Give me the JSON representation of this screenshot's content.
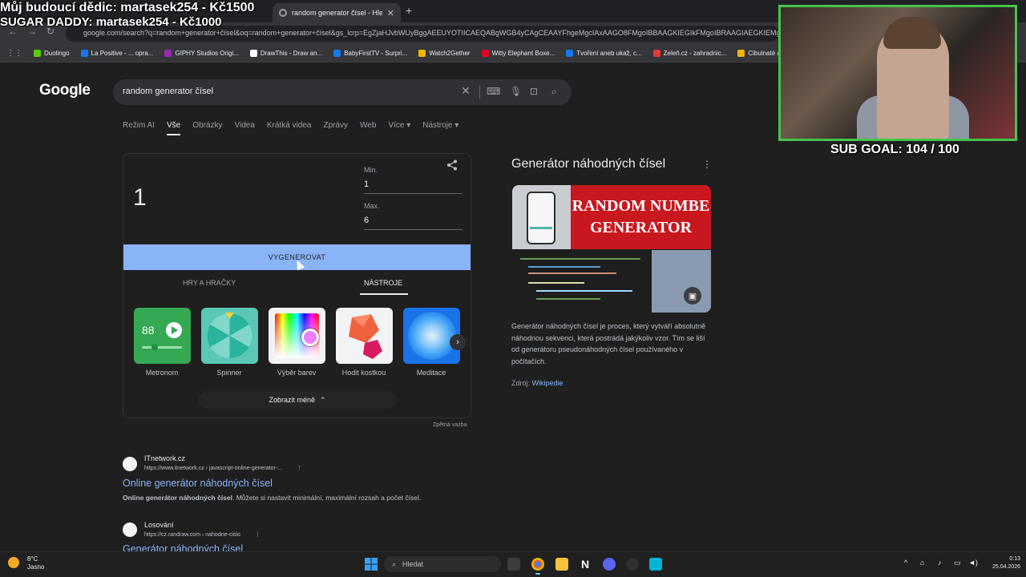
{
  "overlay": {
    "donor_line": "Můj budoucí dědic: martasek254 - Kč1500",
    "sugar_line": "SUGAR DADDY: martasek254 - Kč1000",
    "sub_goal": "SUB GOAL: 104 / 100"
  },
  "browser": {
    "tab_title": "random generator čísel - Hleda",
    "tab_close": "✕",
    "new_tab": "+",
    "url": "google.com/search?q=random+generator+čísel&oq=random+generator+čísel&gs_lcrp=EgZjaHJvbWUyBggAEEUYOTIICAEQABgWGB4yCAgCEAAYFhgeMgcIAxAAGO8FMgoIBBAAGKIEGIkFMgoIBRAAGIAEGKIEMgcIBhAAGO8F",
    "bookmarks": [
      {
        "label": "Duolingo",
        "color": "#58cc02"
      },
      {
        "label": "La Positive - ... opra...",
        "color": "#1877f2"
      },
      {
        "label": "GIPHY Studios Origi...",
        "color": "#9c27b0"
      },
      {
        "label": "DrawThis - Draw an...",
        "color": "#ffffff"
      },
      {
        "label": "BabyFirstTV - Surpri...",
        "color": "#1877f2"
      },
      {
        "label": "Watch2Gether",
        "color": "#f4b400"
      },
      {
        "label": "Witty Elephant Boxe...",
        "color": "#e60023"
      },
      {
        "label": "Tvoření aneb ukaž, c...",
        "color": "#1877f2"
      },
      {
        "label": "Zeleň.cz - zahradnic...",
        "color": "#e53935"
      },
      {
        "label": "Cibulnaté a hlízna...",
        "color": "#f4b400"
      }
    ]
  },
  "google": {
    "logo": "Google",
    "query": "random generator čísel",
    "nav_tabs": [
      "Režim AI",
      "Vše",
      "Obrázky",
      "Videa",
      "Krátká videa",
      "Zprávy",
      "Web",
      "Více ▾",
      "Nástroje ▾"
    ],
    "active_tab": "Vše"
  },
  "rng": {
    "result": "1",
    "min_label": "Min.",
    "min_value": "1",
    "max_label": "Max.",
    "max_value": "6",
    "generate_label": "VYGENEROVAT",
    "tab_games": "HRY A HRAČKY",
    "tab_tools": "NÁSTROJE",
    "metronome_bpm": "88",
    "tools": {
      "metronome": "Metronom",
      "spinner": "Spinner",
      "colorpicker": "Výběr barev",
      "dice": "Hodit kostkou",
      "meditate": "Meditace"
    },
    "show_less": "Zobrazit méně",
    "feedback": "Zpětná vazba"
  },
  "knowledge_panel": {
    "title": "Generátor náhodných čísel",
    "image_text_1": "RANDOM NUMBE",
    "image_text_2": "GENERATOR",
    "description": "Generátor náhodných čísel je proces, který vytváří absolutně náhodnou sekvenci, která postrádá jakýkoliv vzor. Tím se liší od generátoru pseudonáhodných čísel používaného v počítačích.",
    "source_label": "Zdroj:",
    "source_link": "Wikipedie"
  },
  "results": [
    {
      "site": "ITnetwork.cz",
      "url": "https://www.itnetwork.cz › javascript-online-generator-...",
      "title": "Online generátor náhodných čísel",
      "snippet_bold": "Online generátor náhodných čísel",
      "snippet_rest": ". Můžete si nastavit minimální, maximální rozsah a počet čísel."
    },
    {
      "site": "Losování",
      "url": "https://cz.randraw.com › nahodne-cislo",
      "title": "Generátor náhodných čísel"
    }
  ],
  "taskbar": {
    "weather_temp": "8°C",
    "weather_state": "Jasno",
    "search_label": "Hledat",
    "time": "0:13",
    "date": "25.04.2026"
  }
}
